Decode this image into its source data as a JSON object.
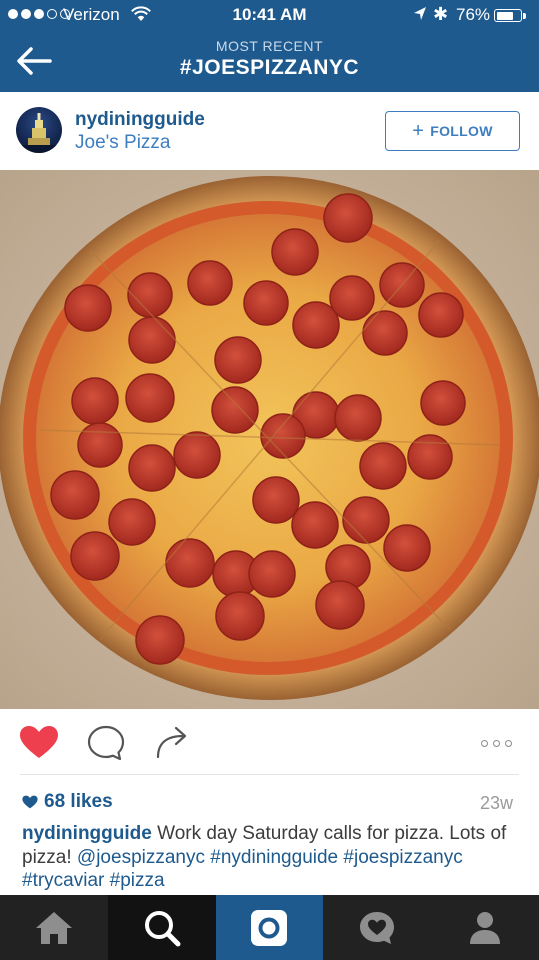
{
  "status_bar": {
    "carrier": "Verizon",
    "time": "10:41 AM",
    "battery": "76%",
    "battery_level": 0.76,
    "signal_bars_filled": 3,
    "signal_bars_total": 5
  },
  "nav": {
    "subtitle": "MOST RECENT",
    "title": "#JOESPIZZANYC",
    "back_icon": "back-arrow-icon"
  },
  "post": {
    "username": "nydiningguide",
    "location": "Joe's Pizza",
    "follow_label": "FOLLOW",
    "photo_description_icon": "pizza-photo",
    "likes": "68 likes",
    "age": "23w",
    "caption_user": "nydiningguide",
    "caption_text": " Work day Saturday calls for pizza. Lots of pizza! ",
    "tags": [
      "@joespizzanyc",
      "#nydiningguide",
      "#joespizzanyc",
      "#trycaviar",
      "#pizza"
    ]
  },
  "actions": {
    "liked": true,
    "icons": [
      "heart-icon",
      "comment-icon",
      "share-icon",
      "more-icon"
    ]
  },
  "tabs": [
    {
      "icon": "home-icon"
    },
    {
      "icon": "search-icon",
      "active": true
    },
    {
      "icon": "camera-icon"
    },
    {
      "icon": "activity-icon"
    },
    {
      "icon": "profile-icon"
    }
  ],
  "colors": {
    "header": "#1e5a8e",
    "accent": "#3e7ec0",
    "like": "#ed3f4e",
    "tabbar": "#222222"
  }
}
